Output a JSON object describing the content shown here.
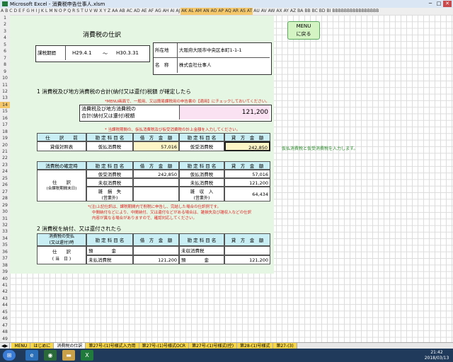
{
  "window": {
    "title": "Microsoft Excel - 消費税申告仕事人.xlsm"
  },
  "columns": [
    "A",
    "B",
    "C",
    "D",
    "E",
    "F",
    "G",
    "H",
    "I",
    "J",
    "K",
    "L",
    "M",
    "N",
    "O",
    "P",
    "Q",
    "R",
    "S",
    "T",
    "U",
    "V",
    "W",
    "X",
    "Y",
    "Z",
    "AA",
    "AB",
    "AC",
    "AD",
    "AE",
    "AF",
    "AG",
    "AH",
    "AI",
    "AJ",
    "AK",
    "AL",
    "AM",
    "AN",
    "AO",
    "AP",
    "AQ",
    "AR",
    "AS",
    "AT",
    "AU",
    "AV",
    "AW",
    "AX",
    "AY",
    "AZ",
    "BA",
    "BB",
    "BC",
    "BD",
    "BI",
    "BBBBBBBBBBBBBBBB"
  ],
  "rows": [
    "1",
    "2",
    "3",
    "4",
    "5",
    "6",
    "7",
    "8",
    "9",
    "10",
    "11",
    "12",
    "13",
    "14",
    "15",
    "16",
    "17",
    "18",
    "19",
    "20",
    "21",
    "22",
    "23",
    "24",
    "25",
    "26",
    "27",
    "28",
    "29",
    "30",
    "31",
    "32",
    "33",
    "34",
    "35",
    "36",
    "37",
    "38",
    "39",
    "40",
    "41",
    "42",
    "43",
    "44",
    "45",
    "46",
    "47",
    "48",
    "49"
  ],
  "menu_button": {
    "line1": "MENU",
    "line2": "に戻る"
  },
  "form": {
    "title": "消費税の仕訳",
    "period_label": "課税期間",
    "period_from": "H29.4.1",
    "period_sep": "～",
    "period_to": "H30.3.31",
    "address_label": "所在地",
    "address": "大阪府大阪市中央区本町1-1-1",
    "name_label": "名　称",
    "name": "株式会社仕事人",
    "section1": "1  消費税及び地方消費税の合計(納付又は還付)税額  が確定したら",
    "note1": "*MENU画面で、一般用、又は簡易課税用の申告書の【適用】にチェックしておいてください。",
    "total_label1": "消費税及び地方消費税の",
    "total_label2": "合計(納付又は還付)税額",
    "total_value": "121,200",
    "note2": "* 当課税期間の、仮払消費税及び仮受消費税の計上金額を入力してください。",
    "hdr_shiwake": "仕　　訳　　前",
    "hdr_kanjo": "勘 定 科 目 名",
    "hdr_debit": "借　方　金　額",
    "hdr_credit": "貸　方　金　額",
    "r14_label": "貸借対照表",
    "r14_debit_acc": "仮払消費税",
    "r14_debit_val": "57,016",
    "r14_credit_acc": "仮受消費税",
    "r14_credit_val": "242,850",
    "side_note": "仮払消費税と仮受消費税を入力します。",
    "hdr_kakutei": "消費税の確定時",
    "shiwake_label": "仕　　訳",
    "shiwake_sub": "(合課税期間末日)",
    "k1_acc": "仮受消費税",
    "k1_val": "242,850",
    "k1_cacc": "仮払消費税",
    "k1_cval": "57,016",
    "k2_acc": "未収消費税",
    "k2_cacc": "未払消費税",
    "k2_cval": "121,200",
    "k3_acc": "雑　損　失",
    "k3_sub": "(営業外)",
    "k3_cacc": "雑　収　入",
    "k3_csub": "(営業外)",
    "k3_cval": "64,434",
    "note3a": "*(注)上記仕訳は、課税期間内で削税に申告し、完結した場合の仕訳例です。",
    "note3b": "中間納付などにより、中間納付、又は還付などがある場合は、雑損失及び雑収入などの仕訳",
    "note3c": "内容が異なる場合がありますので、確認対応してください。",
    "section2": "2  消費税を納付、又は還付されたら",
    "hdr_nofu1": "消費税の受払",
    "hdr_nofu2": "(又は還付)時",
    "n_shiwake": "仕　　訳",
    "n_sub": "( 当　日 )",
    "n1_acc": "預　　　　金",
    "n1_cacc": "未収消費税",
    "n2_acc": "未払消費税",
    "n2_val": "121,200",
    "n2_cacc": "預　　　　金",
    "n2_cval": "121,200"
  },
  "tabs": [
    "MENU",
    "はじめに",
    "消費税の仕訳",
    "第27号-(1)号様式入力用",
    "第27号-(1)号様式OCR",
    "第27号-(1)号様式(控)",
    "第28-(1)号様式",
    "第27-(3)"
  ],
  "active_tab": "消費税の仕訳",
  "taskbar": {
    "time": "21:42",
    "date": "2018/03/13"
  },
  "colors": {
    "form_bg": "#e5f6e2",
    "cyan": "#c9eef3",
    "yellow": "#fdf5c5",
    "pink": "#fae2f2",
    "note_red": "#d22222",
    "tab_yellow": "#f7d64a"
  }
}
